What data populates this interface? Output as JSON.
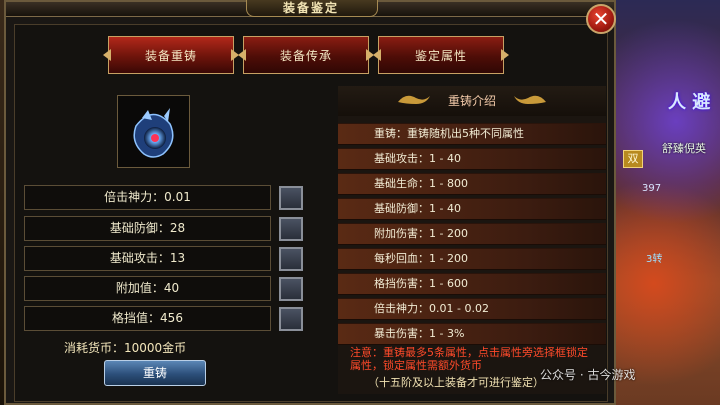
{
  "window": {
    "title": "装备鉴定",
    "close_symbol": "✕"
  },
  "tabs": [
    {
      "label": "装备重铸",
      "active": true
    },
    {
      "label": "装备传承",
      "active": false
    },
    {
      "label": "鉴定属性",
      "active": false
    }
  ],
  "item": {
    "icon": "gem-amulet-icon"
  },
  "attributes": [
    {
      "label": "倍击神力：0.01"
    },
    {
      "label": "基础防御：28"
    },
    {
      "label": "基础攻击：13"
    },
    {
      "label": "附加值：40"
    },
    {
      "label": "格挡值：456"
    }
  ],
  "cost": "消耗货币：10000金币",
  "recast_button": "重铸",
  "intro": {
    "title": "重铸介绍",
    "rows": [
      "重铸：重铸随机出5种不同属性",
      "基础攻击：1 - 40",
      "基础生命：1 - 800",
      "基础防御：1 - 40",
      "附加伤害：1 - 200",
      "每秒回血：1 - 200",
      "格挡伤害：1 - 600",
      "倍击神力：0.01 - 0.02",
      "暴击伤害：1 - 3%"
    ],
    "notice": "注意：重铸最多5条属性，点击属性旁选择框锁定属性，锁定属性需额外货币",
    "notice2": "（十五阶及以上装备才可进行鉴定）"
  },
  "background": {
    "badge": "双",
    "player_name": "舒臻倪英",
    "num1": "397",
    "num2": "3转"
  },
  "watermark": "公众号 · 古今游戏",
  "colors": {
    "tab_red": "#8a1d12",
    "button_blue": "#2c4f7a",
    "notice_red": "#ff4a2a",
    "row_brown": "#5a2a14"
  }
}
